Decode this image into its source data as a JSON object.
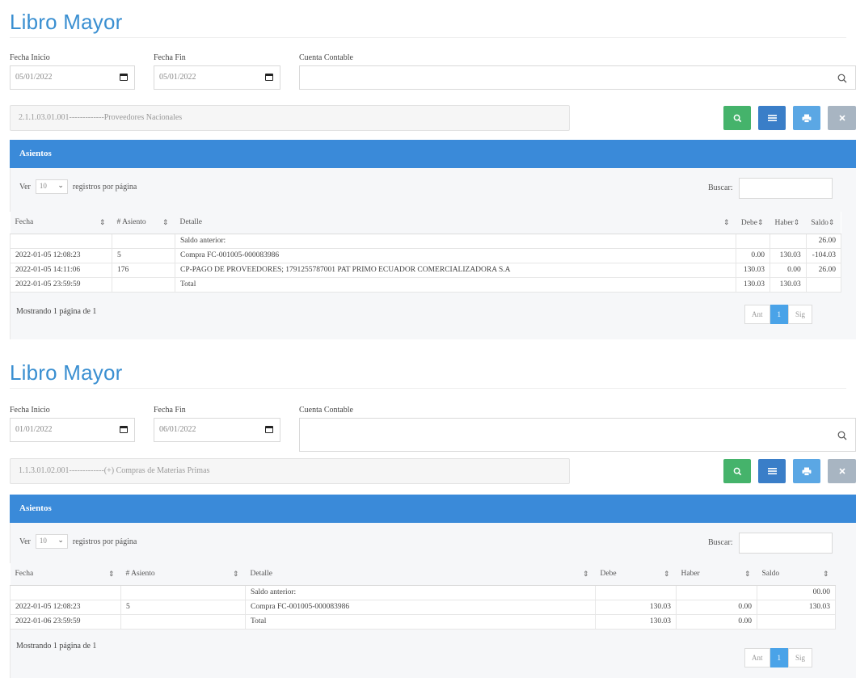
{
  "panels": [
    {
      "title": "Libro Mayor",
      "labels": {
        "inicio": "Fecha Inicio",
        "fin": "Fecha Fin",
        "cuenta": "Cuenta Contable"
      },
      "inputs": {
        "inicio": "05/01/2022",
        "fin": "05/01/2022",
        "cuenta": ""
      },
      "cuenta_display": "2.1.1.03.01.001-------------Proveedores Nacionales",
      "section_title": "Asientos",
      "length_menu": {
        "ver": "Ver",
        "value": "10",
        "suffix": "registros por página"
      },
      "buscar": "Buscar:",
      "columns": [
        "Fecha",
        "# Asiento",
        "Detalle",
        "Debe",
        "Haber",
        "Saldo"
      ],
      "rows": [
        [
          "",
          "",
          "Saldo anterior:",
          "",
          "",
          "26.00"
        ],
        [
          "2022-01-05 12:08:23",
          "5",
          "Compra FC-001005-000083986",
          "0.00",
          "130.03",
          "-104.03"
        ],
        [
          "2022-01-05 14:11:06",
          "176",
          "CP-PAGO DE PROVEEDORES; 1791255787001 PAT PRIMO ECUADOR COMERCIALIZADORA S.A",
          "130.03",
          "0.00",
          "26.00"
        ],
        [
          "2022-01-05 23:59:59",
          "",
          "Total",
          "130.03",
          "130.03",
          ""
        ]
      ],
      "mostrando": "Mostrando 1 página de 1",
      "pager": {
        "prev": "Ant",
        "page": "1",
        "next": "Sig"
      }
    },
    {
      "title": "Libro Mayor",
      "labels": {
        "inicio": "Fecha Inicio",
        "fin": "Fecha Fin",
        "cuenta": "Cuenta Contable"
      },
      "inputs": {
        "inicio": "01/01/2022",
        "fin": "06/01/2022",
        "cuenta": ""
      },
      "cuenta_display": "1.1.3.01.02.001-------------(+) Compras de Materias Primas",
      "section_title": "Asientos",
      "length_menu": {
        "ver": "Ver",
        "value": "10",
        "suffix": "registros por página"
      },
      "buscar": "Buscar:",
      "columns": [
        "Fecha",
        "# Asiento",
        "Detalle",
        "Debe",
        "Haber",
        "Saldo"
      ],
      "rows": [
        [
          "",
          "",
          "Saldo anterior:",
          "",
          "",
          "00.00"
        ],
        [
          "2022-01-05 12:08:23",
          "5",
          "Compra FC-001005-000083986",
          "130.03",
          "0.00",
          "130.03"
        ],
        [
          "2022-01-06 23:59:59",
          "",
          "Total",
          "130.03",
          "0.00",
          ""
        ]
      ],
      "mostrando": "Mostrando 1 página de 1",
      "pager": {
        "prev": "Ant",
        "page": "1",
        "next": "Sig"
      }
    }
  ],
  "colors": {
    "accent": "#3a8ad9",
    "title": "#3a8fd1",
    "search_btn": "#45b36b",
    "list_btn": "#3a7ec8",
    "print_btn": "#5ba7e4",
    "clear_btn": "#a8b5c2"
  }
}
